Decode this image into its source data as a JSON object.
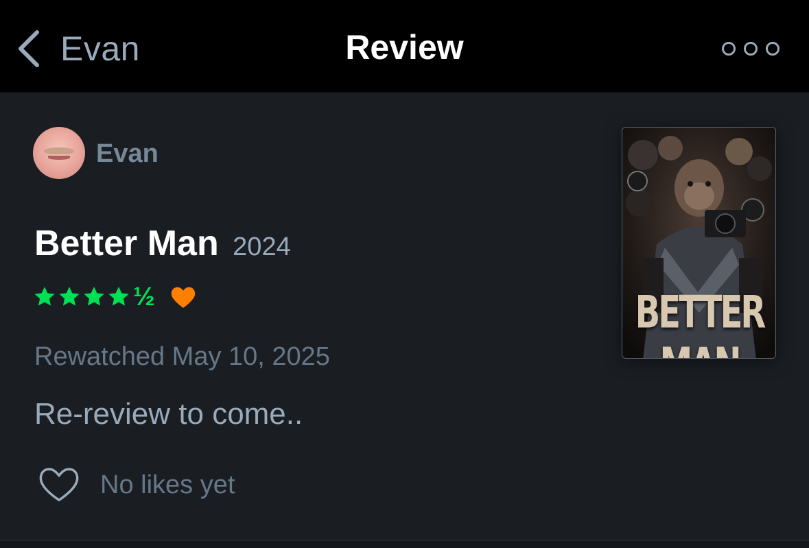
{
  "navbar": {
    "back_label": "Evan",
    "title": "Review"
  },
  "review": {
    "username": "Evan",
    "film_title": "Better Man",
    "film_year": "2024",
    "rating": 4.5,
    "rating_half_glyph": "½",
    "liked": true,
    "watch_date": "Rewatched May 10, 2025",
    "text": "Re-review to come..",
    "likes_label": "No likes yet",
    "poster_title": "BETTER MAN"
  },
  "colors": {
    "star": "#00e054",
    "liked_heart": "#ff8000",
    "background": "#14181c",
    "navbar": "#000000"
  },
  "icons": {
    "back": "chevron-left-icon",
    "more": "more-dots-icon",
    "star": "star-icon",
    "liked": "heart-filled-icon",
    "like": "heart-outline-icon"
  }
}
